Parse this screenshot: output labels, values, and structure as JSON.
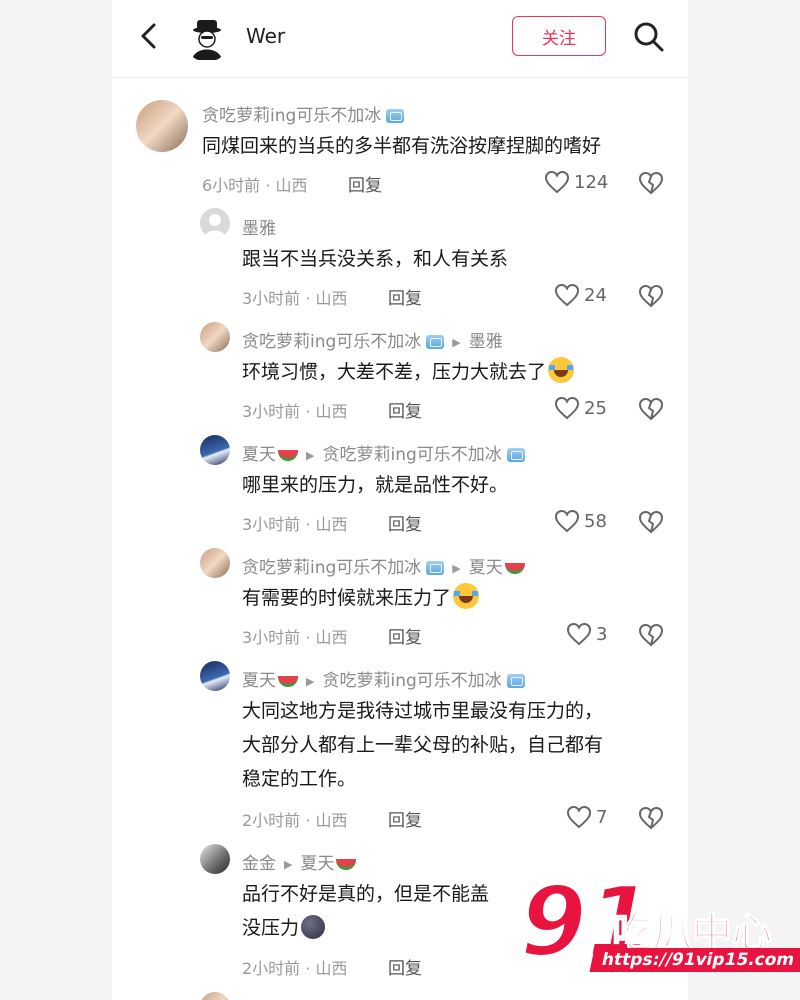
{
  "header": {
    "user_name": "Wer",
    "follow_label": "关注"
  },
  "comments": [
    {
      "author": "贪吃萝莉ing可乐不加冰",
      "text": "同煤回来的当兵的多半都有洗浴按摩捏脚的嗜好",
      "meta": "6小时前 · 山西",
      "reply_label": "回复",
      "likes": "124"
    },
    {
      "author": "墨雅",
      "text": "跟当不当兵没关系，和人有关系",
      "meta": "3小时前 · 山西",
      "reply_label": "回复",
      "likes": "24"
    },
    {
      "author": "贪吃萝莉ing可乐不加冰",
      "reply_to": "墨雅",
      "text": "环境习惯，大差不差，压力大就去了",
      "meta": "3小时前 · 山西",
      "reply_label": "回复",
      "likes": "25"
    },
    {
      "author": "夏天",
      "reply_to": "贪吃萝莉ing可乐不加冰",
      "text": "哪里来的压力，就是品性不好。",
      "meta": "3小时前 · 山西",
      "reply_label": "回复",
      "likes": "58"
    },
    {
      "author": "贪吃萝莉ing可乐不加冰",
      "reply_to": "夏天",
      "text": "有需要的时候就来压力了",
      "meta": "3小时前 · 山西",
      "reply_label": "回复",
      "likes": "3"
    },
    {
      "author": "夏天",
      "reply_to": "贪吃萝莉ing可乐不加冰",
      "text_lines": [
        "大同这地方是我待过城市里最没有压力的，",
        "大部分人都有上一辈父母的补贴，自己都有",
        "稳定的工作。"
      ],
      "meta": "2小时前 · 山西",
      "reply_label": "回复",
      "likes": "7"
    },
    {
      "author": "金金",
      "reply_to": "夏天",
      "text_lines": [
        "品行不好是真的，但是不能盖",
        "没压力"
      ],
      "meta": "2小时前 · 山西",
      "reply_label": "回复"
    }
  ],
  "watermark": {
    "number": "91",
    "title": "吃瓜中心",
    "url": "https://91vip15.com"
  },
  "colors": {
    "accent": "#e5375a",
    "watermark_red": "#e8133e",
    "meta_gray": "#9a9a9a"
  }
}
